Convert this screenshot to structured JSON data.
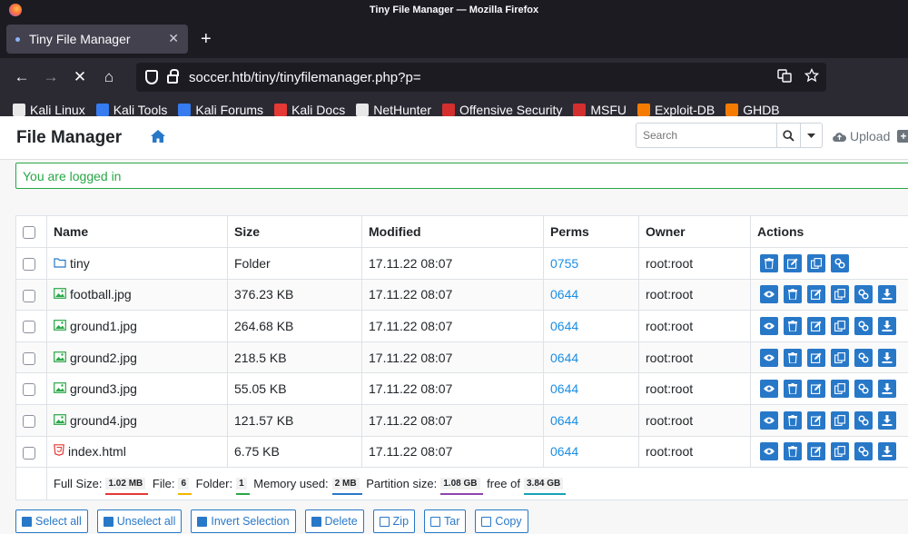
{
  "window": {
    "title": "Tiny File Manager — Mozilla Firefox"
  },
  "tab": {
    "label": "Tiny File Manager",
    "close": "✕",
    "new_tab": "+"
  },
  "nav": {
    "back": "←",
    "forward": "→",
    "reload": "✕",
    "home": "⌂"
  },
  "url": {
    "value": "soccer.htb/tiny/tinyfilemanager.php?p="
  },
  "bookmarks": [
    {
      "label": "Kali Linux",
      "color": "#e8e8e8"
    },
    {
      "label": "Kali Tools",
      "color": "#367bf0"
    },
    {
      "label": "Kali Forums",
      "color": "#367bf0"
    },
    {
      "label": "Kali Docs",
      "color": "#e53935"
    },
    {
      "label": "NetHunter",
      "color": "#e8e8e8"
    },
    {
      "label": "Offensive Security",
      "color": "#d32f2f"
    },
    {
      "label": "MSFU",
      "color": "#d32f2f"
    },
    {
      "label": "Exploit-DB",
      "color": "#f57c00"
    },
    {
      "label": "GHDB",
      "color": "#f57c00"
    }
  ],
  "header": {
    "title": "File Manager",
    "search_placeholder": "Search",
    "upload_label": "Upload"
  },
  "alert": {
    "text": "You are logged in"
  },
  "table": {
    "columns": {
      "name": "Name",
      "size": "Size",
      "modified": "Modified",
      "perms": "Perms",
      "owner": "Owner",
      "actions": "Actions"
    },
    "rows": [
      {
        "name": "tiny",
        "type": "folder",
        "size": "Folder",
        "modified": "17.11.22 08:07",
        "perms": "0755",
        "owner": "root:root"
      },
      {
        "name": "football.jpg",
        "type": "image",
        "size": "376.23 KB",
        "modified": "17.11.22 08:07",
        "perms": "0644",
        "owner": "root:root"
      },
      {
        "name": "ground1.jpg",
        "type": "image",
        "size": "264.68 KB",
        "modified": "17.11.22 08:07",
        "perms": "0644",
        "owner": "root:root"
      },
      {
        "name": "ground2.jpg",
        "type": "image",
        "size": "218.5 KB",
        "modified": "17.11.22 08:07",
        "perms": "0644",
        "owner": "root:root"
      },
      {
        "name": "ground3.jpg",
        "type": "image",
        "size": "55.05 KB",
        "modified": "17.11.22 08:07",
        "perms": "0644",
        "owner": "root:root"
      },
      {
        "name": "ground4.jpg",
        "type": "image",
        "size": "121.57 KB",
        "modified": "17.11.22 08:07",
        "perms": "0644",
        "owner": "root:root"
      },
      {
        "name": "index.html",
        "type": "html",
        "size": "6.75 KB",
        "modified": "17.11.22 08:07",
        "perms": "0644",
        "owner": "root:root"
      }
    ],
    "footer": {
      "full_size_label": "Full Size:",
      "full_size": "1.02 MB",
      "file_label": "File:",
      "file_count": "6",
      "folder_label": "Folder:",
      "folder_count": "1",
      "memory_label": "Memory used:",
      "memory": "2 MB",
      "partition_label": "Partition size:",
      "partition": "1.08 GB",
      "free_label": "free of",
      "free_of": "3.84 GB"
    }
  },
  "bottom_buttons": {
    "select_all": "Select all",
    "unselect_all": "Unselect all",
    "invert": "Invert Selection",
    "delete": "Delete",
    "zip": "Zip",
    "tar": "Tar",
    "copy": "Copy"
  },
  "colors": {
    "accent": "#2878c8",
    "link": "#1b8ee4",
    "success": "#28a745"
  }
}
